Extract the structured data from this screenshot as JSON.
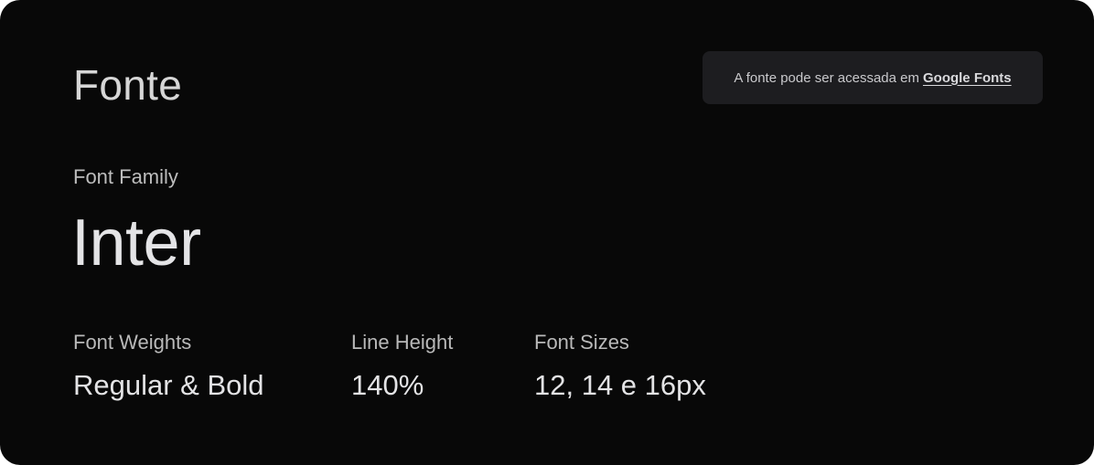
{
  "title": "Fonte",
  "notice": {
    "text": "A fonte pode ser acessada em",
    "link_label": "Google Fonts"
  },
  "font_family": {
    "label": "Font Family",
    "value": "Inter"
  },
  "stats": [
    {
      "label": "Font Weights",
      "value": "Regular & Bold"
    },
    {
      "label": "Line Height",
      "value": "140%"
    },
    {
      "label": "Font Sizes",
      "value": "12, 14 e 16px"
    }
  ],
  "colors": {
    "background": "#080808",
    "notice_background": "#1d1d20",
    "text_primary": "#e4e4e6",
    "text_secondary": "#bdbdbd"
  }
}
